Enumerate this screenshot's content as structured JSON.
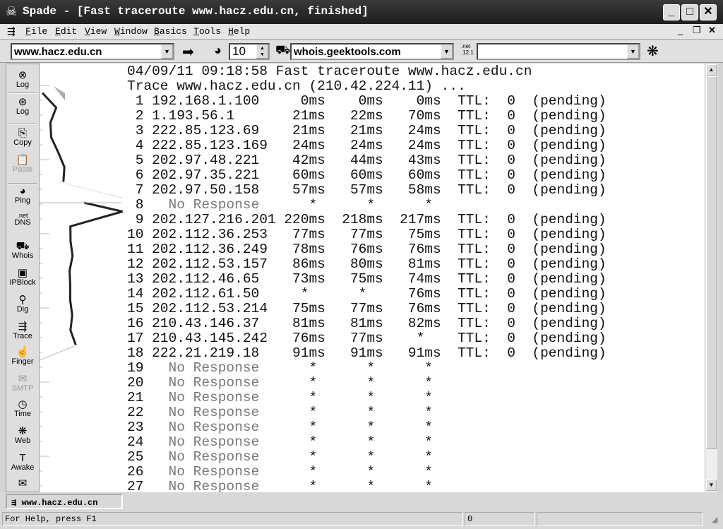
{
  "window": {
    "title": "Spade - [Fast traceroute www.hacz.edu.cn, finished]",
    "buttons": [
      "minimize",
      "maximize",
      "close"
    ]
  },
  "menu": [
    "File",
    "Edit",
    "View",
    "Window",
    "Basics",
    "Tools",
    "Help"
  ],
  "toolbar": {
    "host": "www.hacz.edu.cn",
    "go_icon": "arrow-right-icon",
    "count": "10",
    "whois_server": "whois.geektools.com",
    "dns_icon_text": ".net .12.1",
    "dns_value": "",
    "web_icon": "web-icon"
  },
  "sidebar": [
    {
      "label": "Log",
      "icon": "log-stop-icon",
      "enabled": true
    },
    {
      "label": "Log",
      "icon": "log-icon",
      "enabled": true
    },
    {
      "label": "Copy",
      "icon": "copy-icon",
      "enabled": true
    },
    {
      "label": "Paste",
      "icon": "paste-icon",
      "enabled": false
    },
    {
      "label": "Ping",
      "icon": "ping-icon",
      "enabled": true
    },
    {
      "label": "DNS",
      "icon": "dns-icon",
      "enabled": true
    },
    {
      "label": "Whois",
      "icon": "whois-icon",
      "enabled": true
    },
    {
      "label": "IPBlock",
      "icon": "ipblock-icon",
      "enabled": true
    },
    {
      "label": "Dig",
      "icon": "dig-icon",
      "enabled": true
    },
    {
      "label": "Trace",
      "icon": "trace-icon",
      "enabled": true
    },
    {
      "label": "Finger",
      "icon": "finger-icon",
      "enabled": true
    },
    {
      "label": "SMTP",
      "icon": "smtp-icon",
      "enabled": false
    },
    {
      "label": "Time",
      "icon": "time-icon",
      "enabled": true
    },
    {
      "label": "Web",
      "icon": "web-icon",
      "enabled": true
    },
    {
      "label": "Awake",
      "icon": "awake-icon",
      "enabled": true
    },
    {
      "label": "",
      "icon": "mail-icon",
      "enabled": true
    }
  ],
  "output": {
    "header": [
      "04/09/11 09:18:58 Fast traceroute www.hacz.edu.cn",
      "Trace www.hacz.edu.cn (210.42.224.11) ..."
    ],
    "ttl_label": "TTL:",
    "no_response": "No Response",
    "hops": [
      {
        "n": 1,
        "ip": "192.168.1.100",
        "t": [
          "0ms",
          "0ms",
          "0ms"
        ],
        "ttl": "0",
        "status": "(pending)"
      },
      {
        "n": 2,
        "ip": "1.193.56.1",
        "t": [
          "21ms",
          "22ms",
          "70ms"
        ],
        "ttl": "0",
        "status": "(pending)"
      },
      {
        "n": 3,
        "ip": "222.85.123.69",
        "t": [
          "21ms",
          "21ms",
          "24ms"
        ],
        "ttl": "0",
        "status": "(pending)"
      },
      {
        "n": 4,
        "ip": "222.85.123.169",
        "t": [
          "24ms",
          "24ms",
          "24ms"
        ],
        "ttl": "0",
        "status": "(pending)"
      },
      {
        "n": 5,
        "ip": "202.97.48.221",
        "t": [
          "42ms",
          "44ms",
          "43ms"
        ],
        "ttl": "0",
        "status": "(pending)"
      },
      {
        "n": 6,
        "ip": "202.97.35.221",
        "t": [
          "60ms",
          "60ms",
          "60ms"
        ],
        "ttl": "0",
        "status": "(pending)"
      },
      {
        "n": 7,
        "ip": "202.97.50.158",
        "t": [
          "57ms",
          "57ms",
          "58ms"
        ],
        "ttl": "0",
        "status": "(pending)"
      },
      {
        "n": 8,
        "ip": null
      },
      {
        "n": 9,
        "ip": "202.127.216.201",
        "t": [
          "220ms",
          "218ms",
          "217ms"
        ],
        "ttl": "0",
        "status": "(pending)"
      },
      {
        "n": 10,
        "ip": "202.112.36.253",
        "t": [
          "77ms",
          "77ms",
          "75ms"
        ],
        "ttl": "0",
        "status": "(pending)"
      },
      {
        "n": 11,
        "ip": "202.112.36.249",
        "t": [
          "78ms",
          "76ms",
          "76ms"
        ],
        "ttl": "0",
        "status": "(pending)"
      },
      {
        "n": 12,
        "ip": "202.112.53.157",
        "t": [
          "86ms",
          "80ms",
          "81ms"
        ],
        "ttl": "0",
        "status": "(pending)"
      },
      {
        "n": 13,
        "ip": "202.112.46.65",
        "t": [
          "73ms",
          "75ms",
          "74ms"
        ],
        "ttl": "0",
        "status": "(pending)"
      },
      {
        "n": 14,
        "ip": "202.112.61.50",
        "t": [
          "*",
          "*",
          "76ms"
        ],
        "ttl": "0",
        "status": "(pending)"
      },
      {
        "n": 15,
        "ip": "202.112.53.214",
        "t": [
          "75ms",
          "77ms",
          "76ms"
        ],
        "ttl": "0",
        "status": "(pending)"
      },
      {
        "n": 16,
        "ip": "210.43.146.37",
        "t": [
          "81ms",
          "81ms",
          "82ms"
        ],
        "ttl": "0",
        "status": "(pending)"
      },
      {
        "n": 17,
        "ip": "210.43.145.242",
        "t": [
          "76ms",
          "77ms",
          "*"
        ],
        "ttl": "0",
        "status": "(pending)"
      },
      {
        "n": 18,
        "ip": "222.21.219.18",
        "t": [
          "91ms",
          "91ms",
          "91ms"
        ],
        "ttl": "0",
        "status": "(pending)"
      },
      {
        "n": 19,
        "ip": null
      },
      {
        "n": 20,
        "ip": null
      },
      {
        "n": 21,
        "ip": null
      },
      {
        "n": 22,
        "ip": null
      },
      {
        "n": 23,
        "ip": null
      },
      {
        "n": 24,
        "ip": null
      },
      {
        "n": 25,
        "ip": null
      },
      {
        "n": 26,
        "ip": null
      },
      {
        "n": 27,
        "ip": null
      }
    ]
  },
  "tab": {
    "label": "www.hacz.edu.cn"
  },
  "status": {
    "help": "For Help, press F1",
    "count": "0",
    "extra": ""
  }
}
